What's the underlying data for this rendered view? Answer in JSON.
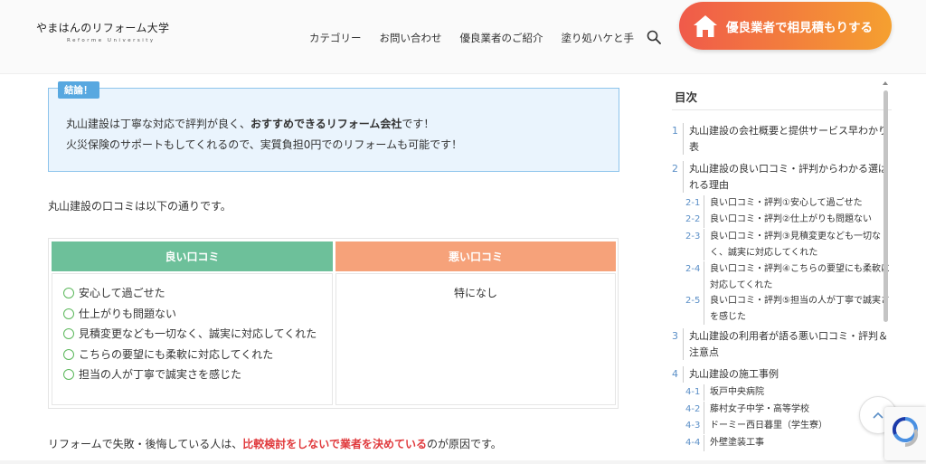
{
  "header": {
    "logo_title": "やまはんのリフォーム大学",
    "logo_subtitle": "Reforme University",
    "nav": [
      "カテゴリー",
      "お問い合わせ",
      "優良業者のご紹介",
      "塗り処ハケと手"
    ],
    "cta_label": "優良業者で相見積もりする"
  },
  "share": [
    {
      "name": "facebook",
      "color": "#3b5998",
      "glyph": "f"
    },
    {
      "name": "x",
      "color": "#111111",
      "glyph": "𝕏"
    },
    {
      "name": "hatena",
      "color": "#00a4de",
      "glyph": "B!"
    },
    {
      "name": "pocket",
      "color": "#ef4056",
      "glyph": "♥"
    },
    {
      "name": "line",
      "color": "#00c300",
      "glyph": "●"
    },
    {
      "name": "copy",
      "color": "#666666",
      "glyph": "▣"
    }
  ],
  "conclusion": {
    "tag": "結論！",
    "line1_pre": "丸山建設は丁寧な対応で評判が良く、",
    "line1_bold": "おすすめできるリフォーム会社",
    "line1_post": "です！",
    "line2": "火災保険のサポートもしてくれるので、実質負担0円でのリフォームも可能です！"
  },
  "intro": "丸山建設の口コミは以下の通りです。",
  "reviews": {
    "good_header": "良い口コミ",
    "bad_header": "悪い口コミ",
    "good_items": [
      "安心して過ごせた",
      "仕上がりも問題ない",
      "見積変更なども一切なく、誠実に対応してくれた",
      "こちらの要望にも柔軟に対応してくれた",
      "担当の人が丁寧で誠実さを感じた"
    ],
    "bad_text": "特になし"
  },
  "bottom": {
    "pre": "リフォームで失敗・後悔している人は、",
    "em": "比較検討をしないで業者を決めている",
    "post": "のが原因です。"
  },
  "toc": {
    "title": "目次",
    "items": [
      {
        "num": "1",
        "text": "丸山建設の会社概要と提供サービス早わかり表"
      },
      {
        "num": "2",
        "text": "丸山建設の良い口コミ・評判からわかる選ばれる理由"
      },
      {
        "num": "2-1",
        "text": "良い口コミ・評判①安心して過ごせた"
      },
      {
        "num": "2-2",
        "text": "良い口コミ・評判②仕上がりも問題ない"
      },
      {
        "num": "2-3",
        "text": "良い口コミ・評判③見積変更なども一切なく、誠実に対応してくれた"
      },
      {
        "num": "2-4",
        "text": "良い口コミ・評判④こちらの要望にも柔軟に対応してくれた"
      },
      {
        "num": "2-5",
        "text": "良い口コミ・評判⑤担当の人が丁寧で誠実さを感じた"
      },
      {
        "num": "3",
        "text": "丸山建設の利用者が語る悪い口コミ・評判＆注意点"
      },
      {
        "num": "4",
        "text": "丸山建設の施工事例"
      },
      {
        "num": "4-1",
        "text": "坂戸中央病院"
      },
      {
        "num": "4-2",
        "text": "藤村女子中学・高等学校"
      },
      {
        "num": "4-3",
        "text": "ドーミー西日暮里（学生寮）"
      },
      {
        "num": "4-4",
        "text": "外壁塗装工事"
      }
    ]
  }
}
